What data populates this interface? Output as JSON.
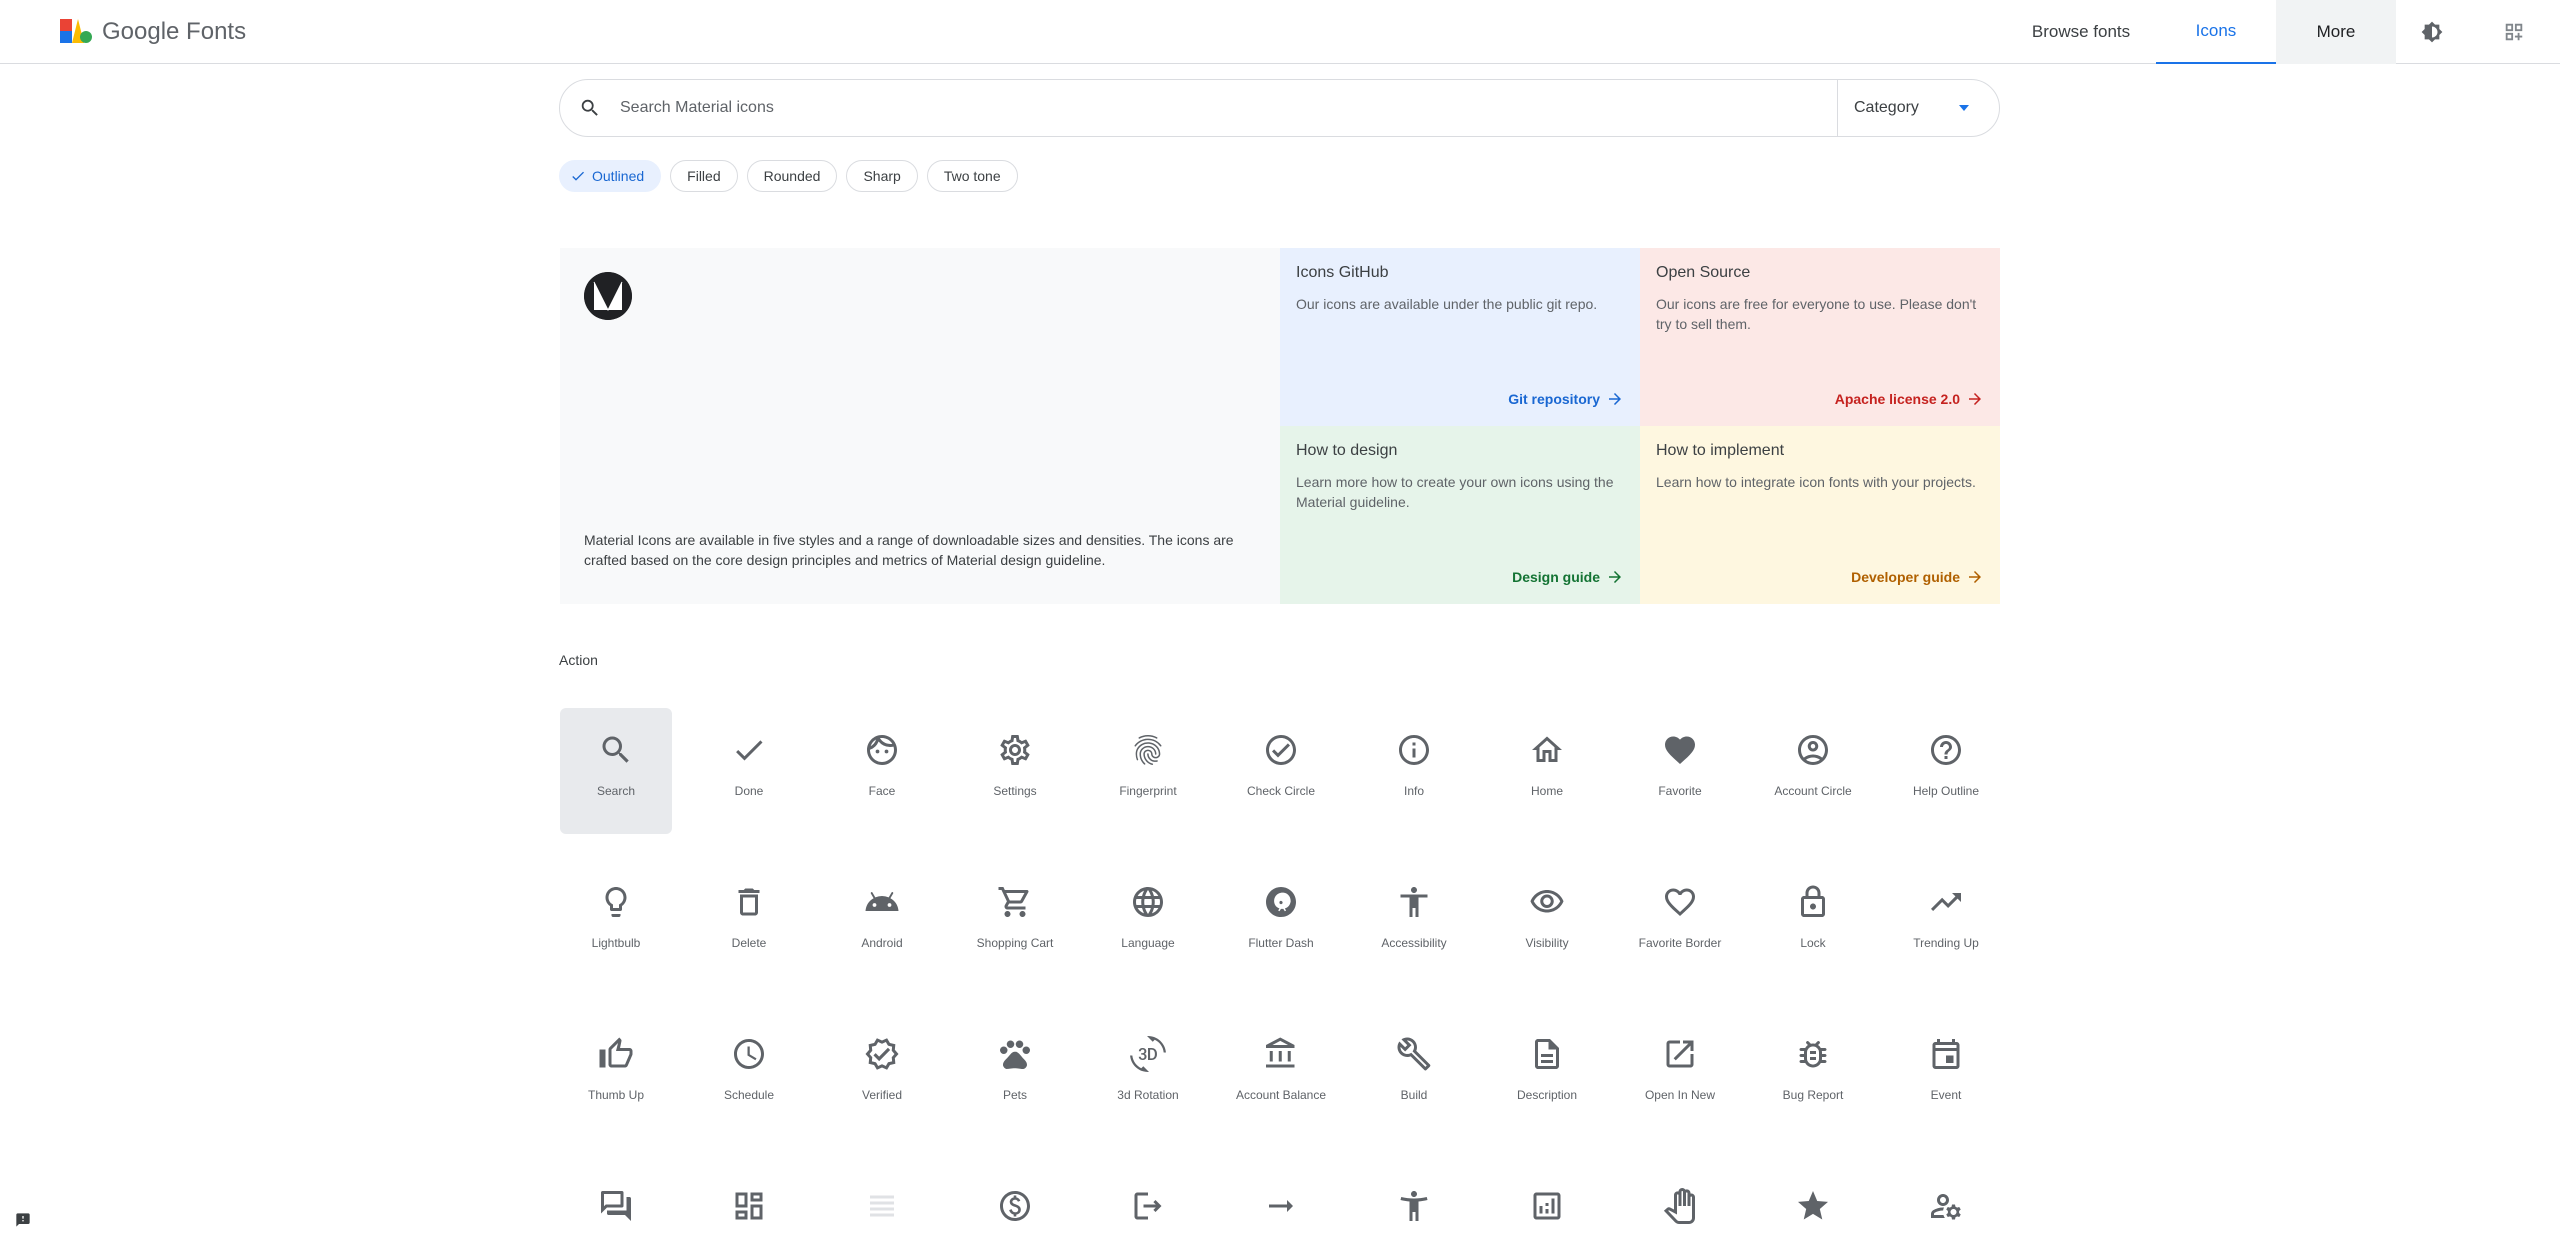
{
  "header": {
    "logo_text": "Google Fonts",
    "nav": {
      "browse": "Browse fonts",
      "icons": "Icons",
      "more": "More"
    }
  },
  "search": {
    "placeholder": "Search Material icons",
    "category_label": "Category"
  },
  "styles": {
    "selected": "Outlined",
    "chips": [
      "Outlined",
      "Filled",
      "Rounded",
      "Sharp",
      "Two tone"
    ]
  },
  "hero": {
    "description": "Material Icons are available in five styles and a range of downloadable sizes and densities. The icons are crafted based on the core design principles and metrics of Material design guideline.",
    "cards": {
      "github": {
        "title": "Icons GitHub",
        "text": "Our icons are available under the public git repo.",
        "link": "Git repository"
      },
      "open_source": {
        "title": "Open Source",
        "text": "Our icons are free for everyone to use. Please don't try to sell them.",
        "link": "Apache license 2.0"
      },
      "design": {
        "title": "How to design",
        "text": "Learn more how to create your own icons using the Material guideline.",
        "link": "Design guide"
      },
      "implement": {
        "title": "How to implement",
        "text": "Learn how to integrate icon fonts with your projects.",
        "link": "Developer guide"
      }
    }
  },
  "section": {
    "title": "Action",
    "icons": [
      {
        "label": "Search",
        "icon": "search-icon"
      },
      {
        "label": "Done",
        "icon": "done-icon"
      },
      {
        "label": "Face",
        "icon": "face-icon"
      },
      {
        "label": "Settings",
        "icon": "settings-icon"
      },
      {
        "label": "Fingerprint",
        "icon": "fingerprint-icon"
      },
      {
        "label": "Check Circle",
        "icon": "check-circle-icon"
      },
      {
        "label": "Info",
        "icon": "info-icon"
      },
      {
        "label": "Home",
        "icon": "home-icon"
      },
      {
        "label": "Favorite",
        "icon": "favorite-icon"
      },
      {
        "label": "Account Circle",
        "icon": "account-circle-icon"
      },
      {
        "label": "Help Outline",
        "icon": "help-outline-icon"
      },
      {
        "label": "Lightbulb",
        "icon": "lightbulb-icon"
      },
      {
        "label": "Delete",
        "icon": "delete-icon"
      },
      {
        "label": "Android",
        "icon": "android-icon"
      },
      {
        "label": "Shopping Cart",
        "icon": "shopping-cart-icon"
      },
      {
        "label": "Language",
        "icon": "language-icon"
      },
      {
        "label": "Flutter Dash",
        "icon": "flutter-dash-icon"
      },
      {
        "label": "Accessibility",
        "icon": "accessibility-icon"
      },
      {
        "label": "Visibility",
        "icon": "visibility-icon"
      },
      {
        "label": "Favorite Border",
        "icon": "favorite-border-icon"
      },
      {
        "label": "Lock",
        "icon": "lock-icon"
      },
      {
        "label": "Trending Up",
        "icon": "trending-up-icon"
      },
      {
        "label": "Thumb Up",
        "icon": "thumb-up-icon"
      },
      {
        "label": "Schedule",
        "icon": "schedule-icon"
      },
      {
        "label": "Verified",
        "icon": "verified-icon"
      },
      {
        "label": "Pets",
        "icon": "pets-icon"
      },
      {
        "label": "3d Rotation",
        "icon": "3d-rotation-icon"
      },
      {
        "label": "Account Balance",
        "icon": "account-balance-icon"
      },
      {
        "label": "Build",
        "icon": "build-icon"
      },
      {
        "label": "Description",
        "icon": "description-icon"
      },
      {
        "label": "Open In New",
        "icon": "open-in-new-icon"
      },
      {
        "label": "Bug Report",
        "icon": "bug-report-icon"
      },
      {
        "label": "Event",
        "icon": "event-icon"
      },
      {
        "label": "",
        "icon": "question-answer-icon"
      },
      {
        "label": "",
        "icon": "dashboard-icon"
      },
      {
        "label": "",
        "icon": "view-headline-icon"
      },
      {
        "label": "",
        "icon": "paid-icon"
      },
      {
        "label": "",
        "icon": "logout-icon"
      },
      {
        "label": "",
        "icon": "arrow-right-alt-icon"
      },
      {
        "label": "",
        "icon": "accessibility-new-icon"
      },
      {
        "label": "",
        "icon": "analytics-icon"
      },
      {
        "label": "",
        "icon": "pan-tool-icon"
      },
      {
        "label": "",
        "icon": "grade-icon"
      },
      {
        "label": "",
        "icon": "manage-accounts-icon"
      }
    ]
  },
  "colors": {
    "accent": "#1a73e8",
    "icon": "#5f6368",
    "github_bg": "#e8f0fe",
    "open_source_bg": "#fce8e6",
    "design_bg": "#e6f4ea",
    "implement_bg": "#fef7e0"
  }
}
